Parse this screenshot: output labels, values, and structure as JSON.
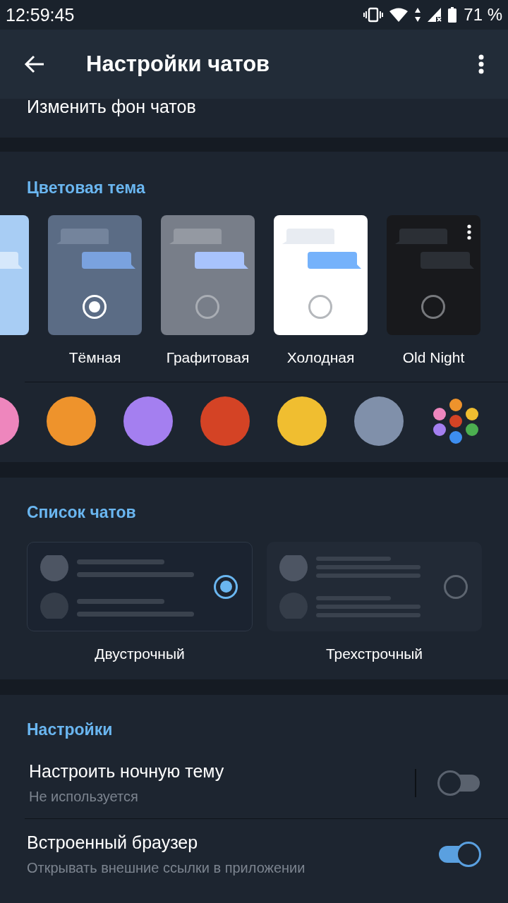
{
  "status_bar": {
    "time": "12:59:45",
    "battery": "71 %"
  },
  "toolbar": {
    "title": "Настройки чатов"
  },
  "background_row": {
    "label": "Изменить фон чатов"
  },
  "color_theme": {
    "heading": "Цветовая тема",
    "themes": [
      {
        "kind": "blue"
      },
      {
        "kind": "dark",
        "label": "Тёмная",
        "selected": true
      },
      {
        "kind": "graphite",
        "label": "Графитовая",
        "selected": false
      },
      {
        "kind": "cold",
        "label": "Холодная",
        "selected": false
      },
      {
        "kind": "custom",
        "label": "Old Night",
        "selected": false
      }
    ],
    "accents": [
      {
        "kind": "swatch",
        "color": "#ee86bd"
      },
      {
        "kind": "swatch",
        "color": "#ee932c"
      },
      {
        "kind": "swatch",
        "color": "#a47ff0"
      },
      {
        "kind": "swatch",
        "color": "#d44325"
      },
      {
        "kind": "swatch",
        "color": "#f0be30"
      },
      {
        "kind": "swatch",
        "color": "#8090aa"
      },
      {
        "kind": "palette"
      }
    ]
  },
  "chat_list": {
    "heading": "Список чатов",
    "options": [
      {
        "kind": "two-line",
        "label": "Двустрочный",
        "selected": true
      },
      {
        "kind": "three-line",
        "label": "Трехстрочный",
        "selected": false
      }
    ]
  },
  "settings": {
    "heading": "Настройки",
    "items": [
      {
        "kind": "split-switch",
        "title": "Настроить ночную тему",
        "subtitle": "Не используется",
        "on": false
      },
      {
        "kind": "switch",
        "title": "Встроенный браузер",
        "subtitle": "Открывать внешние ссылки в приложении",
        "on": true
      }
    ]
  }
}
